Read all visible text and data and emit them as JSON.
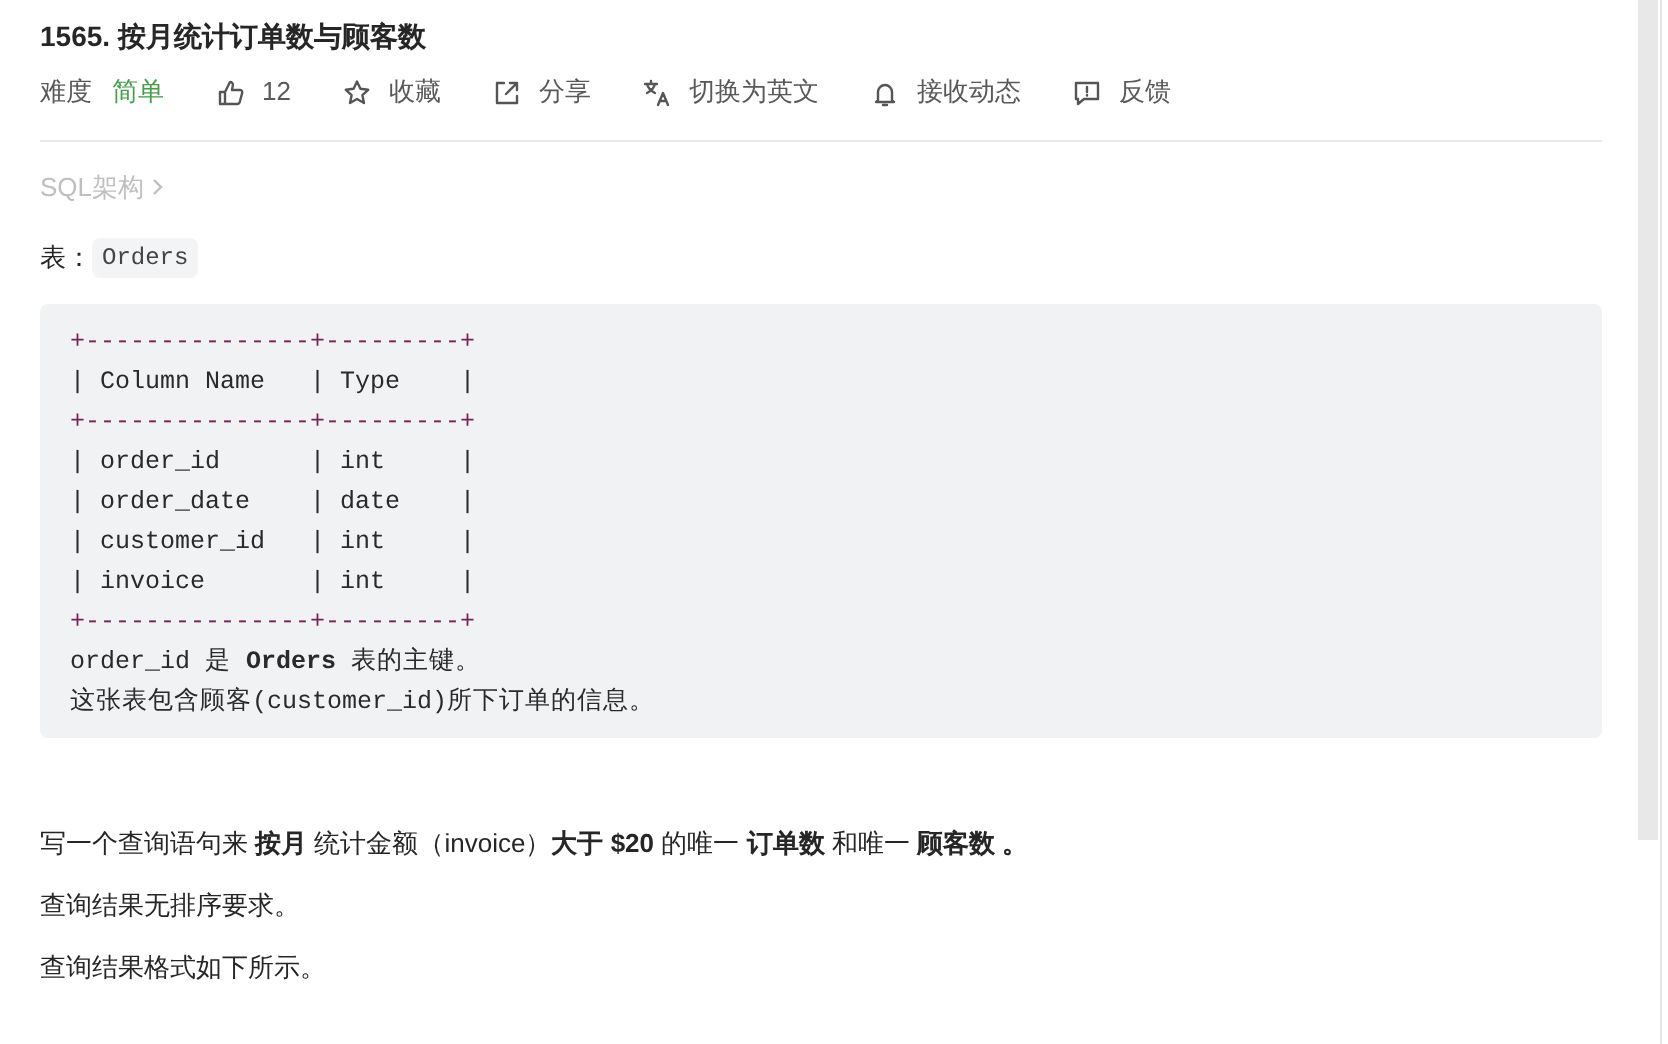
{
  "title": "1565. 按月统计订单数与顾客数",
  "meta": {
    "difficulty_label": "难度",
    "difficulty": "简单",
    "actions": [
      {
        "kind": "like",
        "label": "12"
      },
      {
        "kind": "star",
        "label": "收藏"
      },
      {
        "kind": "share",
        "label": "分享"
      },
      {
        "kind": "translate",
        "label": "切换为英文"
      },
      {
        "kind": "bell",
        "label": "接收动态"
      },
      {
        "kind": "feedback",
        "label": "反馈"
      }
    ]
  },
  "breadcrumb": "SQL架构",
  "table_label": "表：",
  "table_name": "Orders",
  "code_lines": [
    {
      "kind": "border",
      "text": "+---------------+---------+"
    },
    {
      "kind": "row",
      "text": "| Column Name   | Type    |"
    },
    {
      "kind": "border",
      "text": "+---------------+---------+"
    },
    {
      "kind": "row",
      "text": "| order_id      | int     |"
    },
    {
      "kind": "row",
      "text": "| order_date    | date    |"
    },
    {
      "kind": "row",
      "text": "| customer_id   | int     |"
    },
    {
      "kind": "row",
      "text": "| invoice       | int     |"
    },
    {
      "kind": "border",
      "text": "+---------------+---------+"
    },
    {
      "kind": "note",
      "text": "order_id 是 **Orders** 表的主键。"
    },
    {
      "kind": "note",
      "text": "这张表包含顾客(customer_id)所下订单的信息。"
    }
  ],
  "paragraphs": [
    "写一个查询语句来 **按月** 统计金额（invoice）**大于 $20** 的唯一 **订单数** 和唯一 **顾客数 。**",
    "查询结果无排序要求。",
    "查询结果格式如下所示。"
  ]
}
